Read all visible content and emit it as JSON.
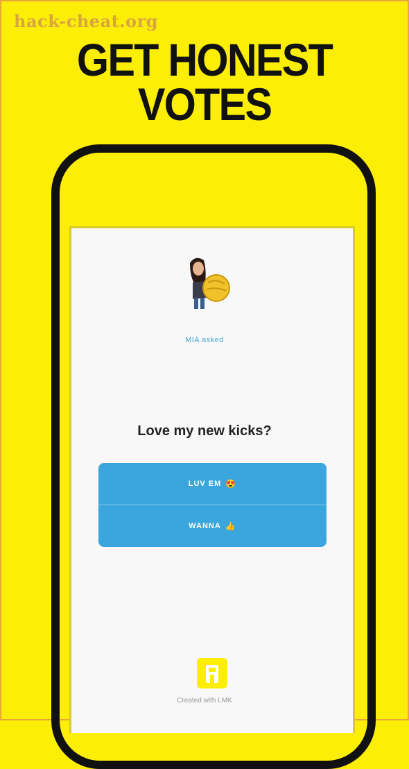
{
  "watermark": "hack-cheat.org",
  "headline": {
    "line1": "GET HONEST",
    "line2": "VOTES"
  },
  "poll": {
    "asker": "MIA asked",
    "question": "Love my new kicks?",
    "options": [
      {
        "label": "LUV EM",
        "emoji": "😍"
      },
      {
        "label": "WANNA",
        "emoji": "👍"
      }
    ]
  },
  "footer": {
    "text": "Created with LMK"
  },
  "icons": {
    "avatar": "bitmoji-avatar-icon",
    "app": "lmk-app-icon"
  },
  "colors": {
    "background": "#fcee06",
    "option_blue": "#3aa6dd",
    "phone_frame": "#111111"
  }
}
